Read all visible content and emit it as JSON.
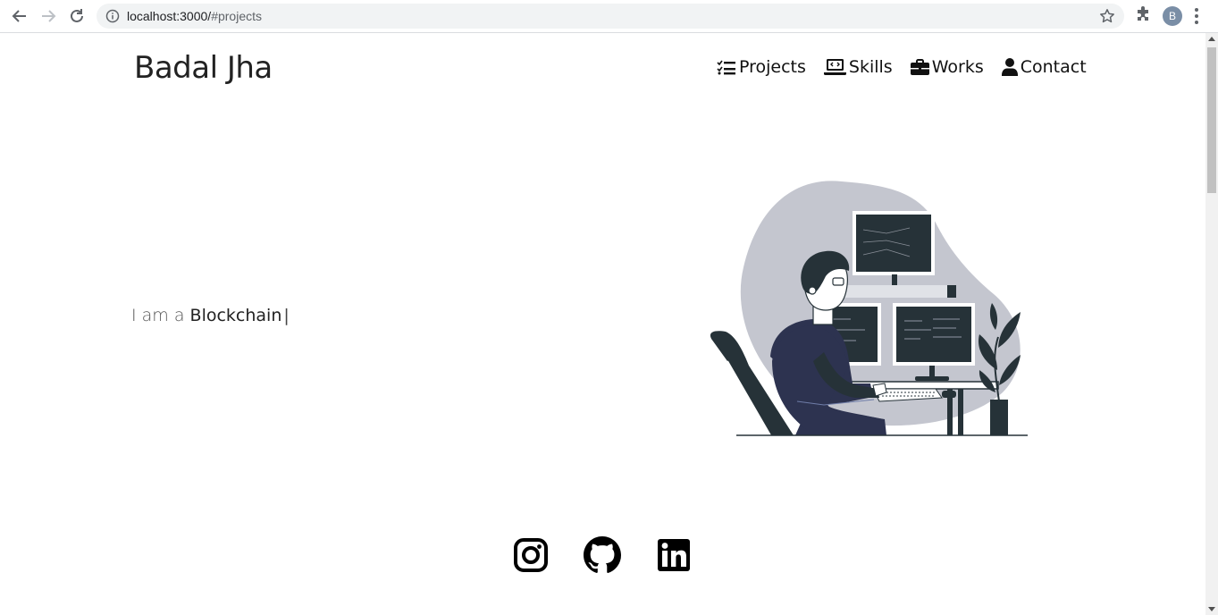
{
  "browser": {
    "url_host": "localhost:3000/",
    "url_path": "#projects",
    "profile_initial": "B"
  },
  "header": {
    "brand": "Badal Jha",
    "nav": [
      {
        "label": "Projects",
        "icon": "tasks-icon"
      },
      {
        "label": "Skills",
        "icon": "laptop-code-icon"
      },
      {
        "label": "Works",
        "icon": "briefcase-icon"
      },
      {
        "label": "Contact",
        "icon": "user-icon"
      }
    ]
  },
  "hero": {
    "prefix": "I am a",
    "typed_word": "Blockchain",
    "cursor": "|"
  },
  "socials": [
    {
      "name": "instagram-icon"
    },
    {
      "name": "github-icon"
    },
    {
      "name": "linkedin-icon"
    }
  ],
  "colors": {
    "text": "#222222",
    "blob": "#c4c6cf",
    "illustration_dark": "#263238"
  }
}
